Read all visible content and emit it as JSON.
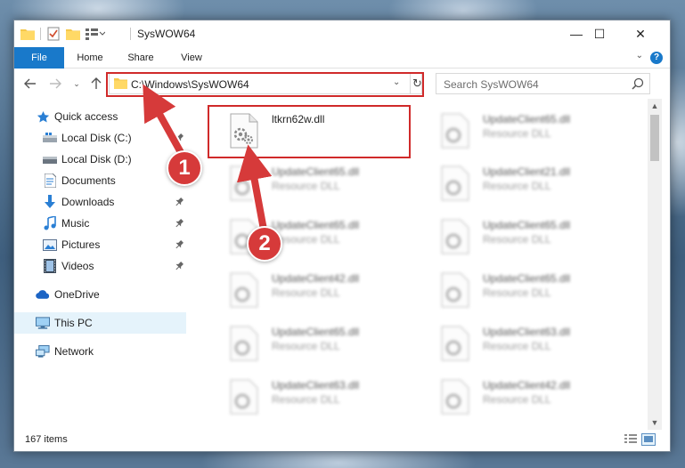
{
  "window": {
    "title": "SysWOW64",
    "controls": {
      "minimize": "—",
      "maximize": "☐",
      "close": "✕"
    }
  },
  "ribbon": {
    "tabs": [
      {
        "label": "File"
      },
      {
        "label": "Home"
      },
      {
        "label": "Share"
      },
      {
        "label": "View"
      }
    ],
    "help": "?"
  },
  "address_bar": {
    "path": "C:\\Windows\\SysWOW64"
  },
  "search": {
    "placeholder": "Search SysWOW64"
  },
  "sidebar": {
    "items": [
      {
        "label": "Quick access",
        "icon": "star-icon"
      },
      {
        "label": "Local Disk (C:)",
        "icon": "drive-icon",
        "pinned": true
      },
      {
        "label": "Local Disk (D:)",
        "icon": "drive-icon"
      },
      {
        "label": "Documents",
        "icon": "documents-icon",
        "pinned": true
      },
      {
        "label": "Downloads",
        "icon": "download-icon",
        "pinned": true
      },
      {
        "label": "Music",
        "icon": "music-icon",
        "pinned": true
      },
      {
        "label": "Pictures",
        "icon": "pictures-icon",
        "pinned": true
      },
      {
        "label": "Videos",
        "icon": "videos-icon",
        "pinned": true
      },
      {
        "label": "OneDrive",
        "icon": "cloud-icon"
      },
      {
        "label": "This PC",
        "icon": "computer-icon",
        "selected": true
      },
      {
        "label": "Network",
        "icon": "network-icon"
      }
    ]
  },
  "files": [
    {
      "name": "ltkrn62w.dll",
      "type": "",
      "highlighted": true
    },
    {
      "name": "UpdateClient65.dll",
      "type": "Resource DLL"
    },
    {
      "name": "UpdateClient65.dll",
      "type": "Resource DLL"
    },
    {
      "name": "UpdateClient21.dll",
      "type": "Resource DLL"
    },
    {
      "name": "UpdateClient65.dll",
      "type": "Resource DLL"
    },
    {
      "name": "UpdateClient65.dll",
      "type": "Resource DLL"
    },
    {
      "name": "UpdateClient42.dll",
      "type": "Resource DLL"
    },
    {
      "name": "UpdateClient65.dll",
      "type": "Resource DLL"
    },
    {
      "name": "UpdateClient65.dll",
      "type": "Resource DLL"
    },
    {
      "name": "UpdateClient63.dll",
      "type": "Resource DLL"
    },
    {
      "name": "UpdateClient63.dll",
      "type": "Resource DLL"
    },
    {
      "name": "UpdateClient42.dll",
      "type": "Resource DLL"
    }
  ],
  "status": {
    "item_count": "167 items"
  },
  "annotations": {
    "marker_1": "1",
    "marker_2": "2",
    "color": "#d02a2a"
  }
}
